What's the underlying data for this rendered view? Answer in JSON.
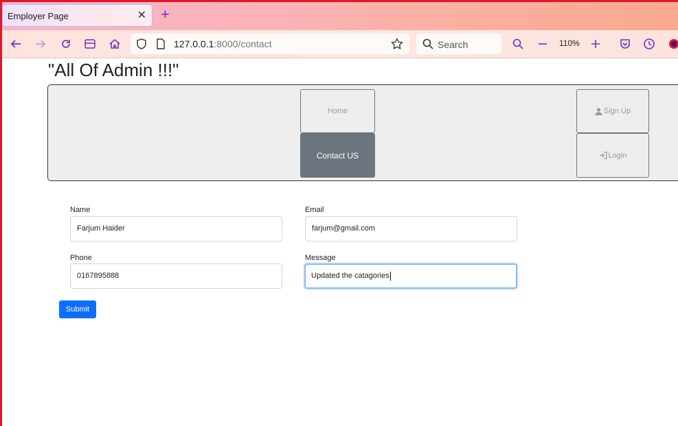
{
  "browser": {
    "tab_title": "Employer Page",
    "url_host": "127.0.0.1",
    "url_path": ":8000/contact",
    "search_placeholder": "Search",
    "zoom": "110%"
  },
  "page": {
    "heading": "\"All Of Admin !!!\"",
    "nav": {
      "home": "Home",
      "contact": "Contact US",
      "signup": "Sign Up",
      "login": "Login"
    },
    "form": {
      "name_label": "Name",
      "name_value": "Farjum Haider",
      "email_label": "Email",
      "email_value": "farjum@gmail.com",
      "phone_label": "Phone",
      "phone_value": "0167895888",
      "message_label": "Message",
      "message_value": "Updated the catagories",
      "submit_label": "Submit"
    }
  },
  "colors": {
    "active_nav": "#6c757d",
    "submit": "#0d6efd",
    "focus_border": "#86b7fe",
    "browser_accent": "#7b2dd6"
  }
}
